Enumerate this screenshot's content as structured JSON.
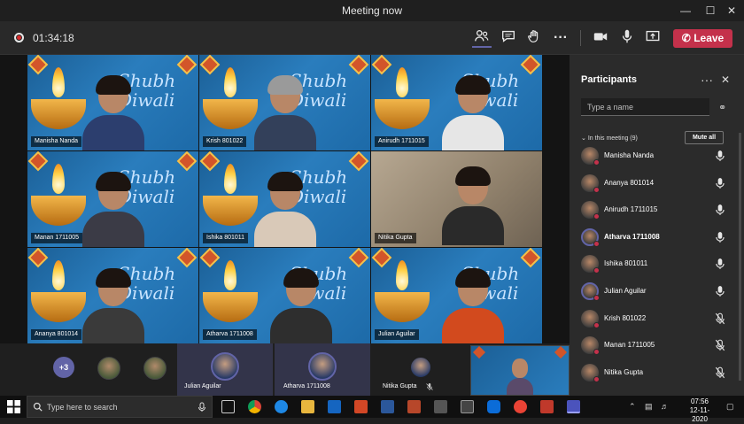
{
  "window": {
    "title": "Meeting now"
  },
  "toolbar": {
    "timer": "01:34:18",
    "leave_label": "Leave"
  },
  "tiles": [
    {
      "name": "Manisha Nanda",
      "shubh": "Shubh",
      "diwali": "Diwali"
    },
    {
      "name": "Krish 801022",
      "shubh": "Shubh",
      "diwali": "Diwali"
    },
    {
      "name": "Anirudh 1711015",
      "shubh": "Shubh",
      "diwali": "Diwali"
    },
    {
      "name": "Manan 1711005",
      "shubh": "Shubh",
      "diwali": "Diwali"
    },
    {
      "name": "Ishika 801011",
      "shubh": "Shubh",
      "diwali": "Diwali"
    },
    {
      "name": "Nitika Gupta"
    },
    {
      "name": "Ananya 801014",
      "shubh": "Shubh",
      "diwali": "Diwali"
    },
    {
      "name": "Atharva 1711008",
      "shubh": "Shubh",
      "diwali": "Diwali"
    },
    {
      "name": "Julian Aguilar",
      "shubh": "Shubh",
      "diwali": "Diwali"
    }
  ],
  "strip": {
    "more_count": "+3",
    "participants": [
      "Julian Aguilar",
      "Atharva 1711008",
      "Nitika Gupta"
    ]
  },
  "panel": {
    "title": "Participants",
    "search_placeholder": "Type a name",
    "section_label": "In this meeting (9)",
    "mute_all_label": "Mute all",
    "people": [
      {
        "name": "Manisha Nanda",
        "muted": false,
        "bold": false
      },
      {
        "name": "Ananya 801014",
        "muted": false,
        "bold": false
      },
      {
        "name": "Anirudh 1711015",
        "muted": false,
        "bold": false
      },
      {
        "name": "Atharva 1711008",
        "muted": false,
        "bold": true
      },
      {
        "name": "Ishika 801011",
        "muted": false,
        "bold": false
      },
      {
        "name": "Julian Aguilar",
        "muted": false,
        "bold": false
      },
      {
        "name": "Krish 801022",
        "muted": true,
        "bold": false
      },
      {
        "name": "Manan 1711005",
        "muted": true,
        "bold": false
      },
      {
        "name": "Nitika Gupta",
        "muted": true,
        "bold": false
      }
    ]
  },
  "taskbar": {
    "search_placeholder": "Type here to search",
    "time": "07:56",
    "date": "12-11-2020"
  },
  "colors": {
    "leave": "#c4314b",
    "accent": "#6264a7",
    "background": "#1f1f1f"
  }
}
